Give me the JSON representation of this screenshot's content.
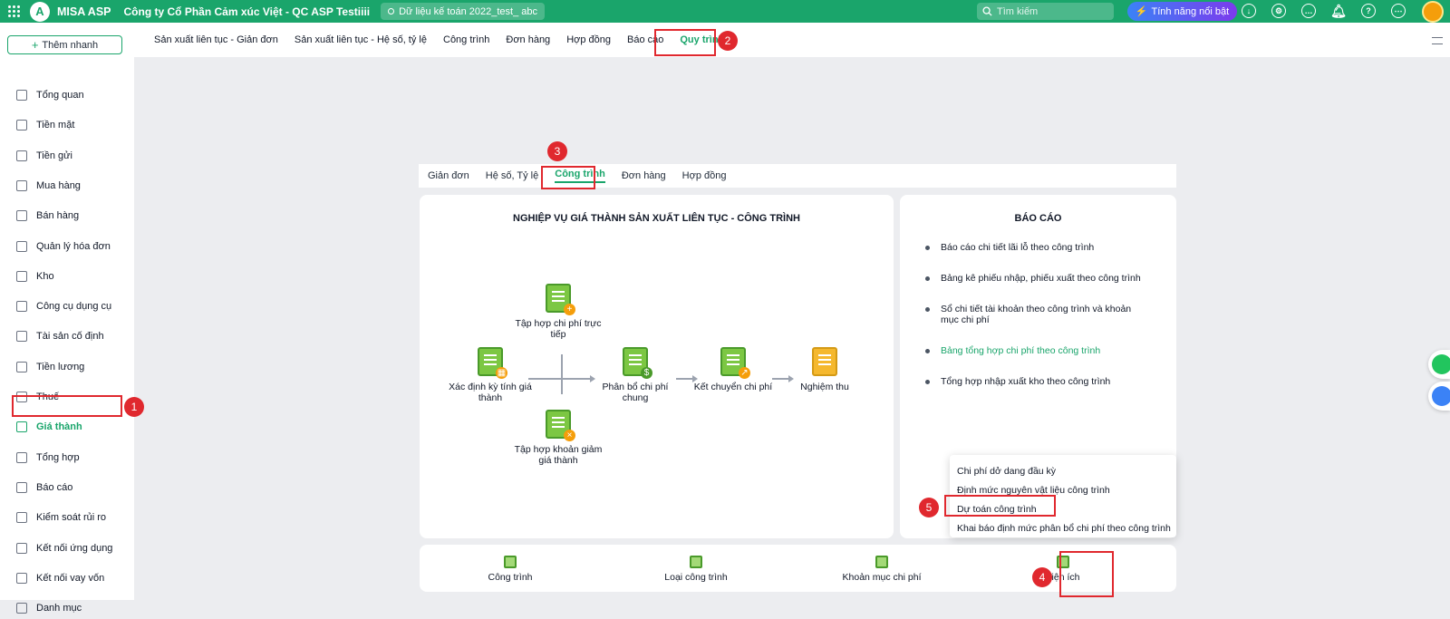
{
  "topbar": {
    "brand": "MISA ASP",
    "company": "Công ty Cổ Phần Cảm xúc Việt - QC ASP Testiiii",
    "dataset": "Dữ liệu kế toán 2022_test_ abc",
    "search_placeholder": "Tìm kiếm",
    "feature_button": "Tính năng nổi bật"
  },
  "sidebar": {
    "add_button": "Thêm nhanh",
    "items": [
      {
        "label": "Tổng quan",
        "icon": "dashboard-icon"
      },
      {
        "label": "Tiền mặt",
        "icon": "cash-icon"
      },
      {
        "label": "Tiền gửi",
        "icon": "bank-icon"
      },
      {
        "label": "Mua hàng",
        "icon": "shopping-bag-icon"
      },
      {
        "label": "Bán hàng",
        "icon": "cart-icon"
      },
      {
        "label": "Quản lý hóa đơn",
        "icon": "invoice-icon"
      },
      {
        "label": "Kho",
        "icon": "warehouse-icon"
      },
      {
        "label": "Công cụ dụng cụ",
        "icon": "tools-icon"
      },
      {
        "label": "Tài sản cố định",
        "icon": "car-icon"
      },
      {
        "label": "Tiền lương",
        "icon": "salary-icon"
      },
      {
        "label": "Thuế",
        "icon": "tax-icon"
      },
      {
        "label": "Giá thành",
        "icon": "cost-icon",
        "active": true
      },
      {
        "label": "Tổng hợp",
        "icon": "summary-icon"
      },
      {
        "label": "Báo cáo",
        "icon": "report-icon"
      },
      {
        "label": "Kiểm soát rủi ro",
        "icon": "risk-icon"
      },
      {
        "label": "Kết nối ứng dụng",
        "icon": "plug-icon"
      },
      {
        "label": "Kết nối vay vốn",
        "icon": "loan-icon"
      },
      {
        "label": "Danh mục",
        "icon": "list-icon"
      }
    ]
  },
  "subnav": {
    "items": [
      "Sản xuất liên tục - Giản đơn",
      "Sản xuất liên tục - Hệ số, tỷ lệ",
      "Công trình",
      "Đơn hàng",
      "Hợp đồng",
      "Báo cáo",
      "Quy trình"
    ],
    "active": "Quy trình"
  },
  "tabs": {
    "items": [
      "Giản đơn",
      "Hệ số, Tỷ lệ",
      "Công trình",
      "Đơn hàng",
      "Hợp đồng"
    ],
    "active": "Công trình"
  },
  "process": {
    "title": "NGHIỆP VỤ GIÁ THÀNH SẢN XUẤT LIÊN TỤC - CÔNG TRÌNH",
    "nodes": {
      "xac_dinh": "Xác định kỳ tính giá thành",
      "tap_hop_truc_tiep": "Tập hợp chi phí trực tiếp",
      "tap_hop_giam": "Tập hợp khoản giảm giá thành",
      "phan_bo": "Phân bổ chi phí chung",
      "ket_chuyen": "Kết chuyển chi phí",
      "nghiem_thu": "Nghiệm thu"
    }
  },
  "reports": {
    "title": "BÁO CÁO",
    "items": [
      "Báo cáo chi tiết lãi lỗ theo công trình",
      "Bảng kê phiếu nhập, phiếu xuất theo công trình",
      "Sổ chi tiết tài khoản theo công trình và khoản mục chi phí",
      "Bảng tổng hợp chi phí theo công trình",
      "Tổng hợp nhập xuất kho theo công trình"
    ]
  },
  "utility_menu": {
    "items": [
      "Chi phí dở dang đầu kỳ",
      "Định mức nguyên vật liệu công trình",
      "Dự toán công trình",
      "Khai báo định mức phân bổ chi phí theo công trình"
    ]
  },
  "bottom_bar": {
    "items": [
      "Công trình",
      "Loại công trình",
      "Khoản mục chi phí",
      "Tiện ích"
    ]
  },
  "callouts": [
    "1",
    "2",
    "3",
    "4",
    "5"
  ],
  "colors": {
    "brand": "#1aa56b",
    "callout": "#e0282e"
  }
}
